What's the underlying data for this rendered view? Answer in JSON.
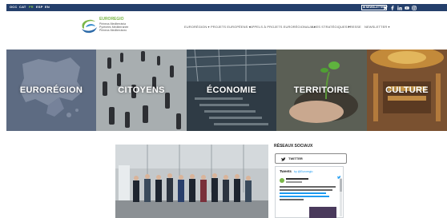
{
  "topbar": {
    "languages": [
      "OCC",
      "CAT",
      "FR",
      "ESP",
      "EN"
    ],
    "newsletter_label": "NEWSLETTER",
    "social_icons": [
      "twitter-icon",
      "facebook-icon",
      "linkedin-icon",
      "youtube-icon",
      "instagram-icon"
    ]
  },
  "logo": {
    "title": "EUROREGIO",
    "lines": [
      "Pirineus Mediterrània",
      "Pyrénées Méditerranée",
      "Pirineos Mediterráneo"
    ]
  },
  "nav": {
    "items": [
      "EURORÉGION ▾",
      "PROJETS EUROPÉENS ▾",
      "APPELS À PROJETS EURORÉGIONAUX ▾",
      "AXES STRATÉGIQUES ▾",
      "PRESSE",
      "NEWSLETTER ▾"
    ]
  },
  "tiles": [
    {
      "label": "EURORÉGION"
    },
    {
      "label": "CITOYENS"
    },
    {
      "label": "ÉCONOMIE"
    },
    {
      "label": "TERRITOIRE"
    },
    {
      "label": "CULTURE"
    }
  ],
  "social": {
    "heading": "RÉSEAUX SOCIAUX",
    "twitter_button": "TWITTER",
    "tweets_heading": "Tweets",
    "tweets_by": "by @Euroregio"
  },
  "colors": {
    "topbar": "#243f6b",
    "logo_green": "#7ab648",
    "logo_blue": "#2c6aa8"
  }
}
